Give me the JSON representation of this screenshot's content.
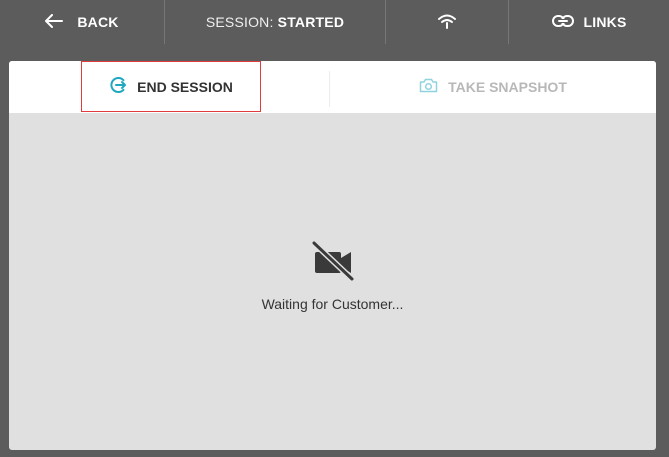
{
  "topbar": {
    "back_label": "BACK",
    "session_prefix": "SESSION: ",
    "session_status": "STARTED",
    "links_label": "LINKS"
  },
  "icons": {
    "back": "arrow-left-icon",
    "wifi": "wifi-icon",
    "links": "link-icon",
    "end_session": "exit-icon",
    "snapshot": "camera-icon",
    "video_off": "video-off-icon"
  },
  "toolbar": {
    "end_session_label": "END SESSION",
    "snapshot_label": "TAKE SNAPSHOT"
  },
  "main": {
    "waiting_text": "Waiting for Customer..."
  },
  "colors": {
    "topbar_bg": "#5c5c5c",
    "accent": "#1fa8c0",
    "highlight_border": "#e23b3b",
    "disabled_text": "#b8b8b8",
    "panel_bg": "#e0e0e0"
  }
}
